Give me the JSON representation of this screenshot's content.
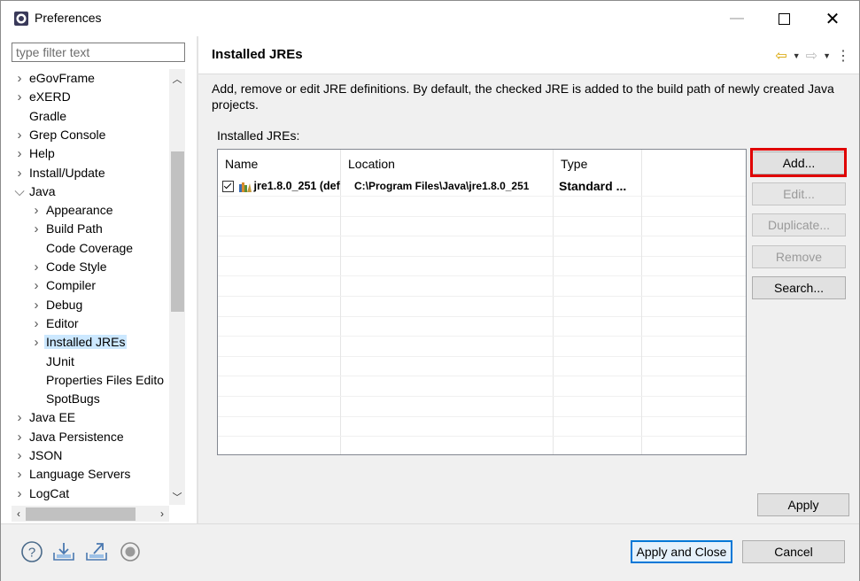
{
  "window": {
    "title": "Preferences"
  },
  "filter": {
    "placeholder": "type filter text"
  },
  "tree": [
    {
      "label": "eGovFrame",
      "chevron": "›",
      "indent": 0
    },
    {
      "label": "eXERD",
      "chevron": "›",
      "indent": 0
    },
    {
      "label": "Gradle",
      "chevron": "",
      "indent": 0
    },
    {
      "label": "Grep Console",
      "chevron": "›",
      "indent": 0
    },
    {
      "label": "Help",
      "chevron": "›",
      "indent": 0
    },
    {
      "label": "Install/Update",
      "chevron": "›",
      "indent": 0
    },
    {
      "label": "Java",
      "chevron": "⌄",
      "indent": 0
    },
    {
      "label": "Appearance",
      "chevron": "›",
      "indent": 1
    },
    {
      "label": "Build Path",
      "chevron": "›",
      "indent": 1
    },
    {
      "label": "Code Coverage",
      "chevron": "",
      "indent": 1
    },
    {
      "label": "Code Style",
      "chevron": "›",
      "indent": 1
    },
    {
      "label": "Compiler",
      "chevron": "›",
      "indent": 1
    },
    {
      "label": "Debug",
      "chevron": "›",
      "indent": 1
    },
    {
      "label": "Editor",
      "chevron": "›",
      "indent": 1
    },
    {
      "label": "Installed JREs",
      "chevron": "›",
      "indent": 1,
      "selected": true
    },
    {
      "label": "JUnit",
      "chevron": "",
      "indent": 1
    },
    {
      "label": "Properties Files Edito",
      "chevron": "",
      "indent": 1
    },
    {
      "label": "SpotBugs",
      "chevron": "",
      "indent": 1
    },
    {
      "label": "Java EE",
      "chevron": "›",
      "indent": 0
    },
    {
      "label": "Java Persistence",
      "chevron": "›",
      "indent": 0
    },
    {
      "label": "JSON",
      "chevron": "›",
      "indent": 0
    },
    {
      "label": "Language Servers",
      "chevron": "›",
      "indent": 0
    },
    {
      "label": "LogCat",
      "chevron": "›",
      "indent": 0
    }
  ],
  "page": {
    "title": "Installed JREs",
    "description": "Add, remove or edit JRE definitions. By default, the checked JRE is added to the build path of newly created Java projects.",
    "jres_label": "Installed JREs:"
  },
  "table": {
    "columns": [
      "Name",
      "Location",
      "Type"
    ],
    "rows": [
      {
        "checked": true,
        "name": "jre1.8.0_251 (def...",
        "location": "C:\\Program Files\\Java\\jre1.8.0_251",
        "type": "Standard ..."
      }
    ]
  },
  "buttons": {
    "add": "Add...",
    "edit": "Edit...",
    "duplicate": "Duplicate...",
    "remove": "Remove",
    "search": "Search...",
    "apply": "Apply",
    "apply_close": "Apply and Close",
    "cancel": "Cancel"
  },
  "colors": {
    "selection": "#cce8ff",
    "highlight": "#e00000",
    "default_button": "#0078d7"
  }
}
